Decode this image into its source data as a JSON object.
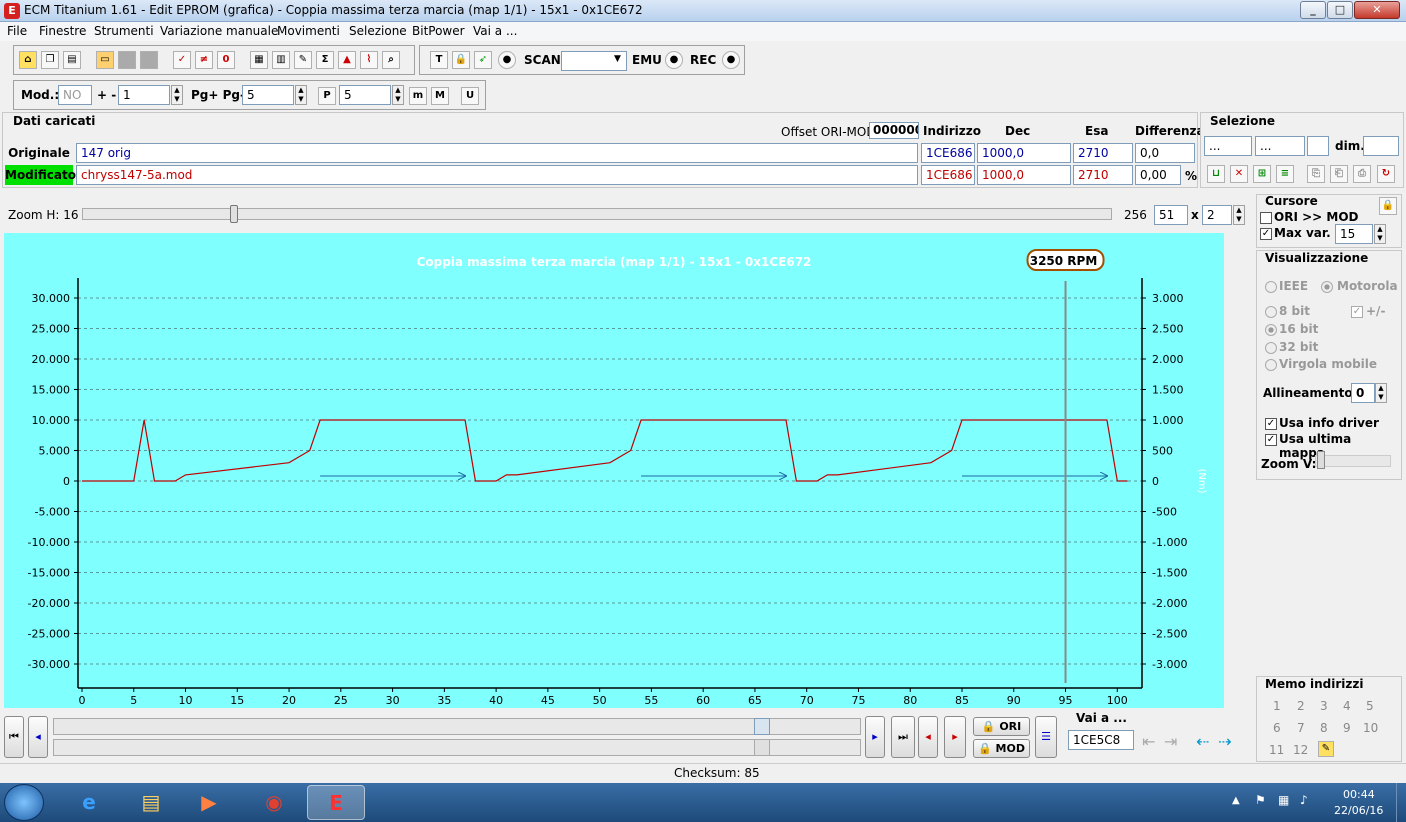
{
  "window": {
    "title": "ECM Titanium 1.61 - Edit EPROM (grafica) - Coppia massima terza marcia (map 1/1) - 15x1 - 0x1CE672"
  },
  "menu": [
    "File",
    "Finestre",
    "Strumenti",
    "Variazione manuale",
    "Movimenti",
    "Selezione",
    "BitPower",
    "Vai a ..."
  ],
  "toolbar": {
    "scan_label": "SCAN",
    "emu_label": "EMU",
    "rec_label": "REC",
    "scan_value": ""
  },
  "toolbar2": {
    "mod_label": "Mod.:",
    "mod_value": "NO",
    "plusminus_label": "+ -",
    "plusminus_value": "1",
    "pg_label": "Pg+ Pg-",
    "pg_value": "5",
    "p_value": "5",
    "p_icon": "P",
    "m_icon": "m",
    "M_icon": "M",
    "u_icon": "U"
  },
  "dati": {
    "title": "Dati caricati",
    "offset_label": "Offset ORI-MOD",
    "offset_value": "000000",
    "headers": {
      "indirizzo": "Indirizzo",
      "dec": "Dec",
      "esa": "Esa",
      "differenza": "Differenza"
    },
    "originale": {
      "label": "Originale",
      "file": "147 orig",
      "indirizzo": "1CE686",
      "dec": "1000,0",
      "esa": "2710",
      "diff": "0,0"
    },
    "modificato": {
      "label": "Modificato",
      "file": "chryss147-5a.mod",
      "indirizzo": "1CE686",
      "dec": "1000,0",
      "esa": "2710",
      "diff": "0,00",
      "pct": "%"
    }
  },
  "selezione": {
    "title": "Selezione",
    "f1": "...",
    "f2": "...",
    "dim_label": "dim."
  },
  "zoom": {
    "label": "Zoom H: 16",
    "max": "256",
    "value": "51",
    "x_label": "x",
    "mult": "2"
  },
  "cursore": {
    "title": "Cursore",
    "ori_mod": "ORI >> MOD",
    "maxvar_label": "Max var.",
    "maxvar_value": "15"
  },
  "visualizzazione": {
    "title": "Visualizzazione",
    "ieee": "IEEE",
    "motorola": "Motorola",
    "b8": "8 bit",
    "pm": "+/-",
    "b16": "16 bit",
    "b32": "32 bit",
    "virgola": "Virgola mobile",
    "allineamento_label": "Allineamento:",
    "allineamento_value": "0",
    "usa_info": "Usa info driver",
    "usa_ultima": "Usa ultima mappa",
    "zoomv_label": "Zoom V:"
  },
  "chart_data": {
    "type": "line",
    "title": "Coppia massima terza marcia (map 1/1) - 15x1 - 0x1CE672",
    "cursor_label": "3250 RPM",
    "cursor_x": 95,
    "right_axis_label": "(Nm)",
    "xlim": [
      0,
      102
    ],
    "ylim": [
      -33000,
      33000
    ],
    "x_ticks": [
      0,
      5,
      10,
      15,
      20,
      25,
      30,
      35,
      40,
      45,
      50,
      55,
      60,
      65,
      70,
      75,
      80,
      85,
      90,
      95,
      100
    ],
    "y_ticks_left": [
      "30.000",
      "25.000",
      "20.000",
      "15.000",
      "10.000",
      "5.000",
      "0",
      "-5.000",
      "-10.000",
      "-15.000",
      "-20.000",
      "-25.000",
      "-30.000"
    ],
    "y_ticks_right": [
      "3.000",
      "2.500",
      "2.000",
      "1.500",
      "1.000",
      "500",
      "0",
      "-500",
      "-1.000",
      "-1.500",
      "-2.000",
      "-2.500",
      "-3.000"
    ],
    "y_tick_values": [
      30000,
      25000,
      20000,
      15000,
      10000,
      5000,
      0,
      -5000,
      -10000,
      -15000,
      -20000,
      -25000,
      -30000
    ],
    "series": [
      {
        "color": "#c00000",
        "x": [
          0,
          5,
          6,
          7,
          8,
          9,
          10,
          20,
          22,
          23,
          37,
          38,
          39,
          40,
          41,
          42,
          51,
          53,
          54,
          68,
          69,
          70,
          71,
          72,
          73,
          82,
          84,
          85,
          99,
          100,
          101
        ],
        "y": [
          0,
          0,
          10000,
          0,
          0,
          0,
          1000,
          3000,
          5000,
          10000,
          10000,
          0,
          0,
          0,
          1000,
          1000,
          3000,
          5000,
          10000,
          10000,
          0,
          0,
          0,
          1000,
          1000,
          3000,
          5000,
          10000,
          10000,
          0,
          0
        ]
      }
    ],
    "arrows": [
      {
        "x1": 23,
        "x2": 37,
        "y": 500
      },
      {
        "x1": 54,
        "x2": 68,
        "y": 500
      },
      {
        "x1": 85,
        "x2": 99,
        "y": 500
      }
    ]
  },
  "nav": {
    "ori_label": "ORI",
    "mod_label": "MOD",
    "vai_label": "Vai a ...",
    "vai_value": "1CE5C8"
  },
  "memo": {
    "title": "Memo indirizzi",
    "nums": [
      "1",
      "2",
      "3",
      "4",
      "5",
      "6",
      "7",
      "8",
      "9",
      "10",
      "11",
      "12"
    ]
  },
  "status": {
    "checksum": "Checksum: 85"
  },
  "taskbar": {
    "time": "00:44",
    "date": "22/06/16"
  }
}
